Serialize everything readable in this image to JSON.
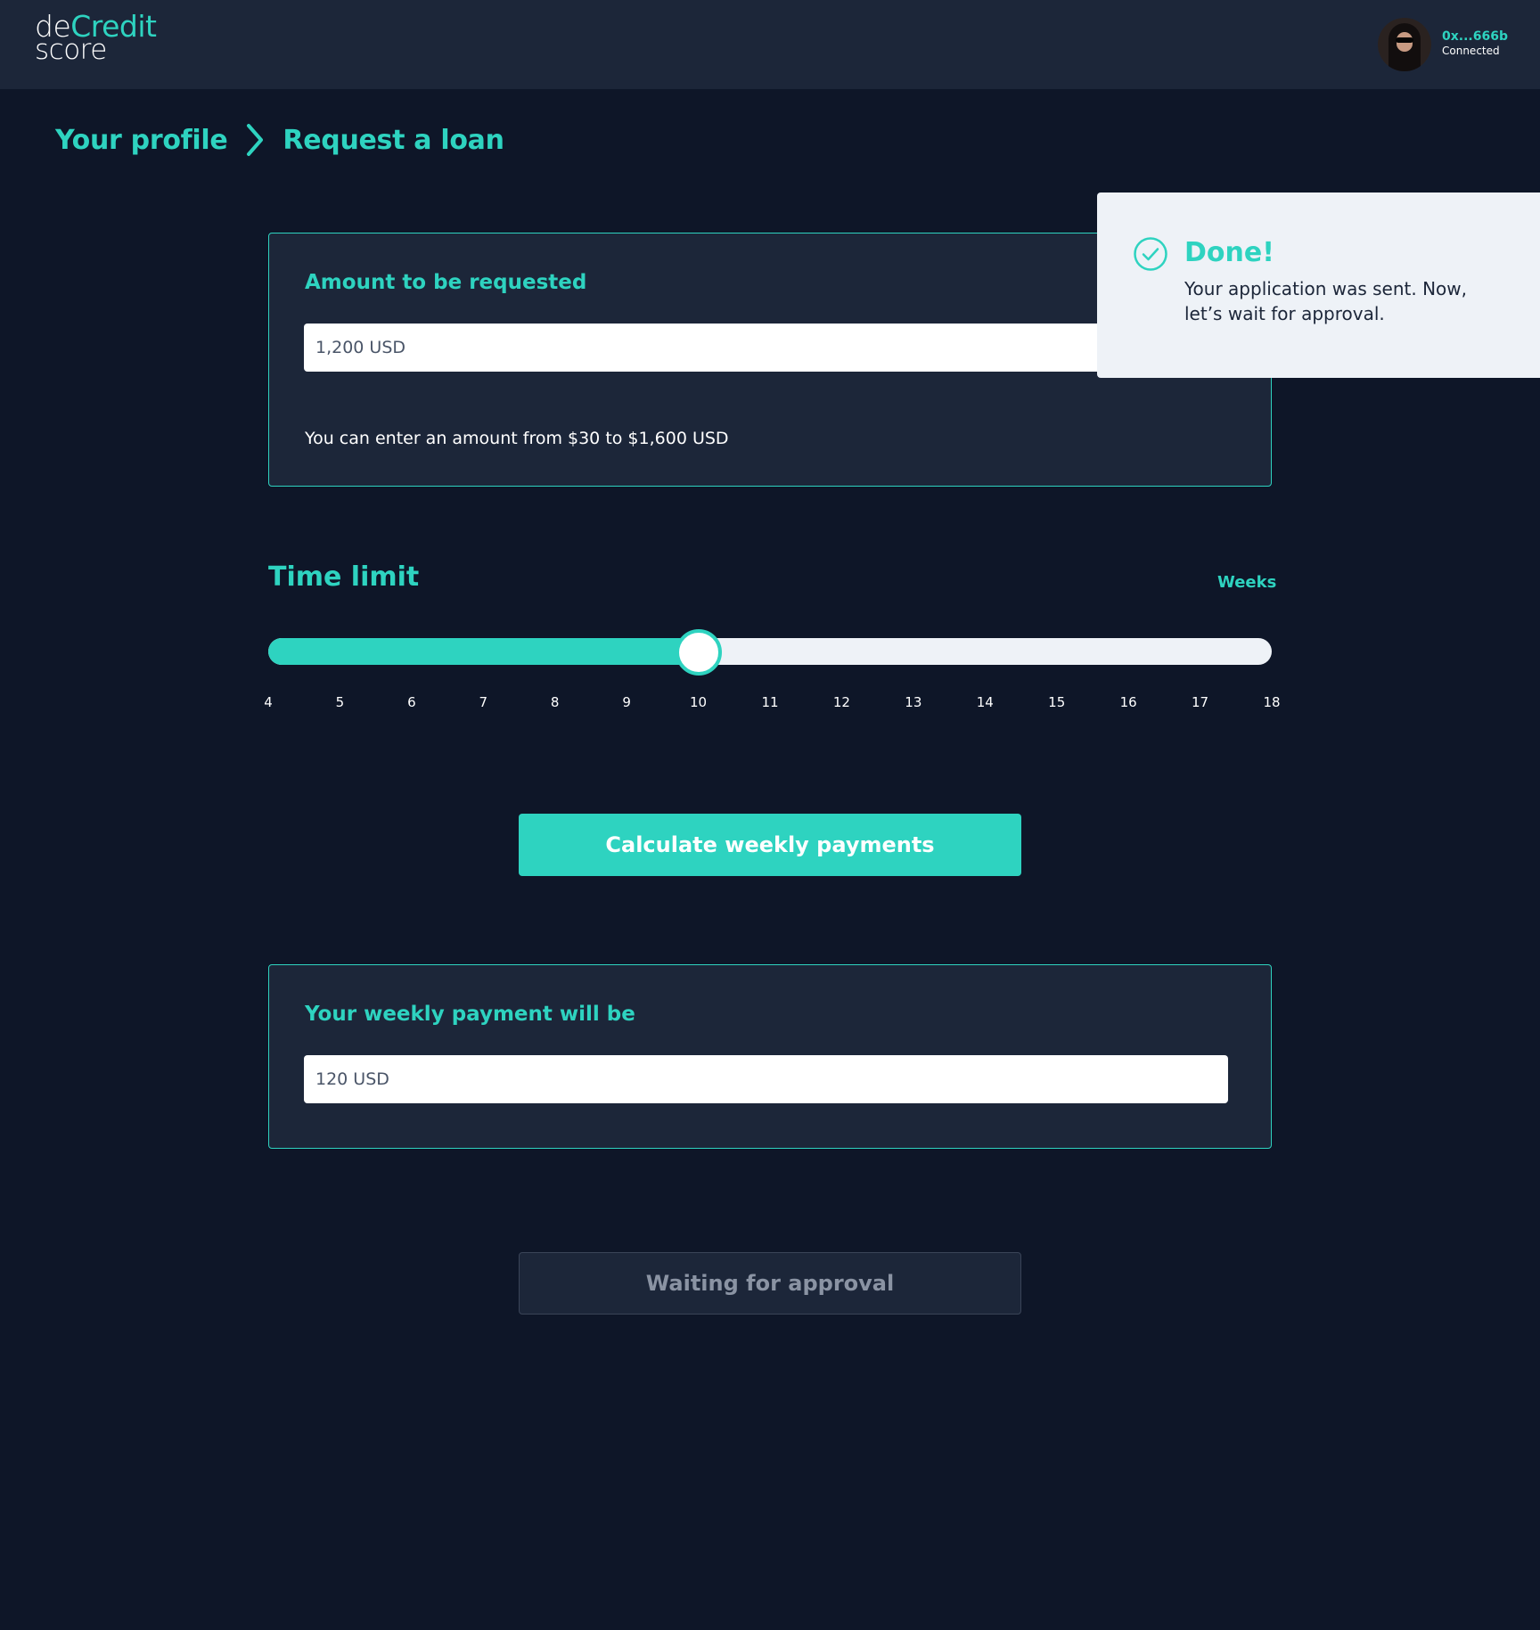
{
  "brand": {
    "logo_part1": "de",
    "logo_part2": "Credit",
    "logo_part3": "score",
    "accent_color": "#2ed3c0"
  },
  "account": {
    "address": "0x...666b",
    "status": "Connected",
    "avatar_icon": "user-avatar"
  },
  "breadcrumb": {
    "items": [
      "Your profile",
      "Request a loan"
    ],
    "separator_icon": "chevron-right-icon"
  },
  "amount_card": {
    "title": "Amount to be requested",
    "value": "1,200 USD",
    "hint": "You can enter an amount from $30 to $1,600 USD"
  },
  "time_limit": {
    "title": "Time limit",
    "unit_label": "Weeks",
    "min": 4,
    "max": 18,
    "value": 10,
    "ticks": [
      "4",
      "5",
      "6",
      "7",
      "8",
      "9",
      "10",
      "11",
      "12",
      "13",
      "14",
      "15",
      "16",
      "17",
      "18"
    ]
  },
  "calculate_button": {
    "label": "Calculate weekly payments"
  },
  "weekly_card": {
    "title": "Your weekly payment will be",
    "value": "120 USD"
  },
  "waiting_button": {
    "label": "Waiting for approval"
  },
  "toast": {
    "title": "Done!",
    "message": "Your application was sent. Now, let’s wait for approval.",
    "icon": "check-circle-icon"
  }
}
